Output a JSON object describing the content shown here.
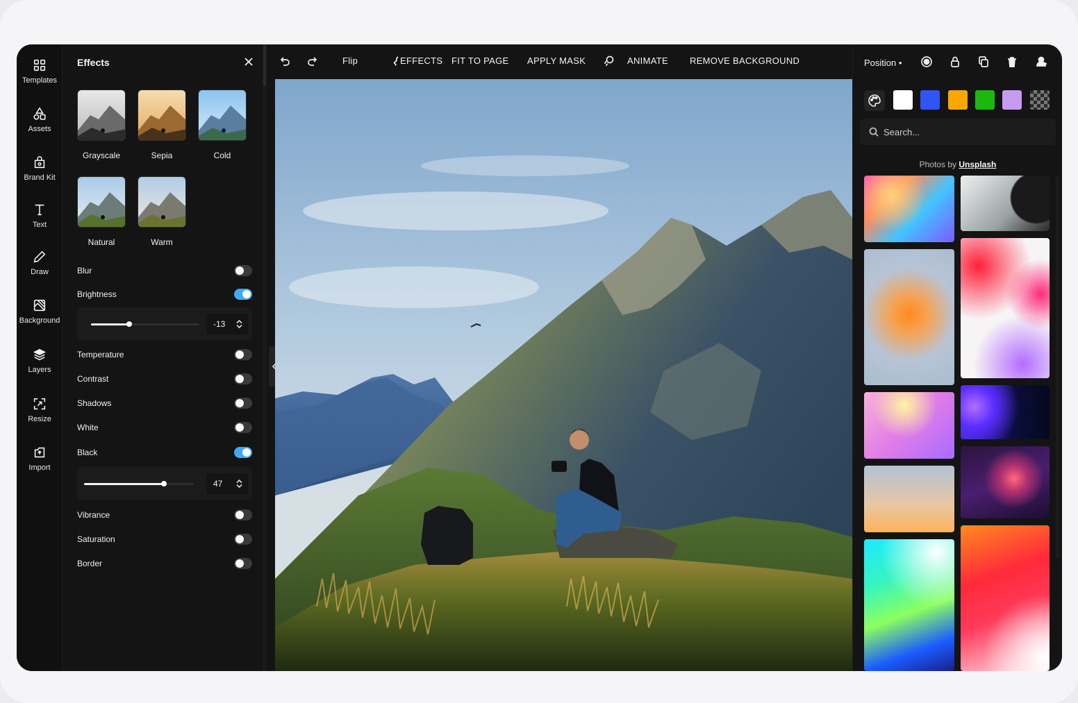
{
  "rail": {
    "items": [
      {
        "label": "Templates",
        "icon": "templates-icon"
      },
      {
        "label": "Assets",
        "icon": "assets-icon"
      },
      {
        "label": "Brand Kit",
        "icon": "brand-kit-icon"
      },
      {
        "label": "Text",
        "icon": "text-icon"
      },
      {
        "label": "Draw",
        "icon": "draw-icon"
      },
      {
        "label": "Background",
        "icon": "background-icon"
      },
      {
        "label": "Layers",
        "icon": "layers-icon"
      },
      {
        "label": "Resize",
        "icon": "resize-icon"
      },
      {
        "label": "Import",
        "icon": "import-icon"
      }
    ]
  },
  "effects": {
    "title": "Effects",
    "presets": [
      "Grayscale",
      "Sepia",
      "Cold",
      "Natural",
      "Warm"
    ],
    "toggles": {
      "blur": {
        "label": "Blur",
        "on": false
      },
      "brightness": {
        "label": "Brightness",
        "on": true,
        "value": "-13",
        "level": 0.35
      },
      "temperature": {
        "label": "Temperature",
        "on": false
      },
      "contrast": {
        "label": "Contrast",
        "on": false
      },
      "shadows": {
        "label": "Shadows",
        "on": false
      },
      "white": {
        "label": "White",
        "on": false
      },
      "black": {
        "label": "Black",
        "on": true,
        "value": "47",
        "level": 0.73
      },
      "vibrance": {
        "label": "Vibrance",
        "on": false
      },
      "saturation": {
        "label": "Saturation",
        "on": false
      },
      "border": {
        "label": "Border",
        "on": false
      }
    }
  },
  "toolbar": {
    "flip": "Flip",
    "effects": "EFFECTS",
    "fit": "FIT TO PAGE",
    "mask": "APPLY MASK",
    "animate": "ANIMATE",
    "remove_bg": "REMOVE BACKGROUND"
  },
  "right": {
    "position_label": "Position •",
    "swatches": [
      "#ffffff",
      "#2f55f4",
      "#f8a800",
      "#1cb80f",
      "#c79af2"
    ],
    "search_placeholder": "Search...",
    "credit_prefix": "Photos by",
    "credit_link": "Unsplash"
  }
}
